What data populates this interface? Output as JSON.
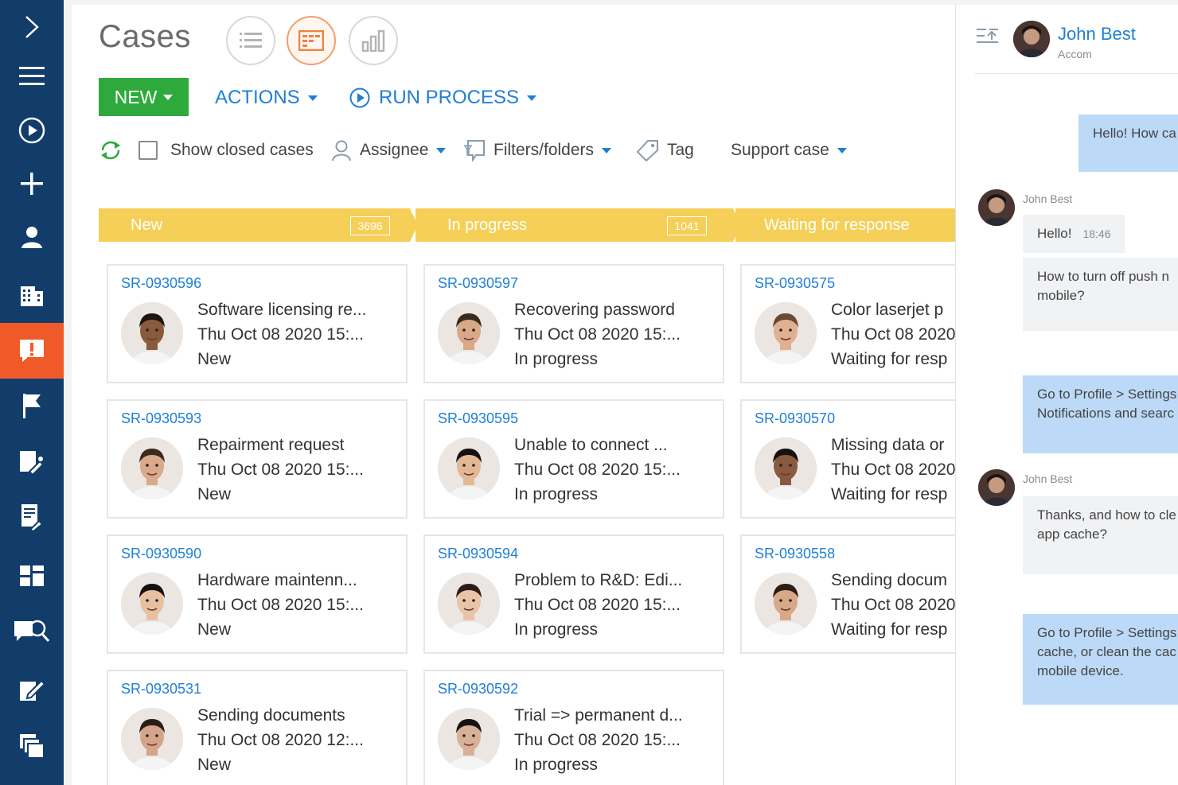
{
  "sidebar": {
    "items": [
      {
        "name": "expand",
        "icon": "chevron-right-icon"
      },
      {
        "name": "menu",
        "icon": "hamburger-icon"
      },
      {
        "name": "processes",
        "icon": "play-circle-icon"
      },
      {
        "name": "add",
        "icon": "plus-icon"
      },
      {
        "name": "contacts",
        "icon": "person-icon"
      },
      {
        "name": "accounts",
        "icon": "building-icon"
      },
      {
        "name": "cases",
        "icon": "alert-chat-icon",
        "active": true
      },
      {
        "name": "activities",
        "icon": "flag-icon"
      },
      {
        "name": "service-requests",
        "icon": "wrench-doc-icon"
      },
      {
        "name": "knowledge",
        "icon": "doc-wrench-icon"
      },
      {
        "name": "dashboards",
        "icon": "dashboard-icon"
      },
      {
        "name": "search-knowledge",
        "icon": "chat-search-icon"
      },
      {
        "name": "documents",
        "icon": "edit-doc-icon"
      },
      {
        "name": "files",
        "icon": "folders-icon"
      }
    ]
  },
  "header": {
    "title": "Cases",
    "views": [
      "list-view-icon",
      "board-view-icon",
      "analytics-view-icon"
    ],
    "active_view": "board-view-icon"
  },
  "toolbar": {
    "new_label": "NEW",
    "actions_label": "ACTIONS",
    "run_process_label": "RUN PROCESS"
  },
  "filters": {
    "show_closed_label": "Show closed cases",
    "assignee_label": "Assignee",
    "filters_label": "Filters/folders",
    "tag_label": "Tag",
    "support_label": "Support case"
  },
  "stages": [
    {
      "label": "New",
      "count": "3696"
    },
    {
      "label": "In progress",
      "count": "1041"
    },
    {
      "label": "Waiting for response",
      "count": ""
    }
  ],
  "columns": [
    {
      "cards": [
        {
          "id": "SR-0930596",
          "subject": "Software licensing re...",
          "date": "Thu Oct 08 2020 15:...",
          "status": "New",
          "avatar": {
            "skin": "#8a5a3c",
            "hair": "#1e1410"
          }
        },
        {
          "id": "SR-0930593",
          "subject": "Repairment request",
          "date": "Thu Oct 08 2020 15:...",
          "status": "New",
          "avatar": {
            "skin": "#d9a98a",
            "hair": "#3a2a20"
          }
        },
        {
          "id": "SR-0930590",
          "subject": "Hardware maintenn...",
          "date": "Thu Oct 08 2020 15:...",
          "status": "New",
          "avatar": {
            "skin": "#e8c0a0",
            "hair": "#141010"
          }
        },
        {
          "id": "SR-0930531",
          "subject": "Sending documents",
          "date": "Thu Oct 08 2020 12:...",
          "status": "New",
          "avatar": {
            "skin": "#d4a58a",
            "hair": "#2a1e18"
          }
        }
      ]
    },
    {
      "cards": [
        {
          "id": "SR-0930597",
          "subject": "Recovering password",
          "date": "Thu Oct 08 2020 15:...",
          "status": "In progress",
          "avatar": {
            "skin": "#d8a888",
            "hair": "#3a2a1e"
          }
        },
        {
          "id": "SR-0930595",
          "subject": "Unable to connect ...",
          "date": "Thu Oct 08 2020 15:...",
          "status": "In progress",
          "avatar": {
            "skin": "#e2b894",
            "hair": "#121010"
          }
        },
        {
          "id": "SR-0930594",
          "subject": "Problem to R&D: Edi...",
          "date": "Thu Oct 08 2020 15:...",
          "status": "In progress",
          "avatar": {
            "skin": "#e8c4a8",
            "hair": "#2c1e16"
          }
        },
        {
          "id": "SR-0930592",
          "subject": "Trial => permanent d...",
          "date": "Thu Oct 08 2020 15:...",
          "status": "In progress",
          "avatar": {
            "skin": "#d8b098",
            "hair": "#161212"
          }
        }
      ]
    },
    {
      "cards": [
        {
          "id": "SR-0930575",
          "subject": "Color laserjet p",
          "date": "Thu Oct 08 2020",
          "status": "Waiting for resp",
          "avatar": {
            "skin": "#e0b090",
            "hair": "#6a4a30"
          }
        },
        {
          "id": "SR-0930570",
          "subject": "Missing data or",
          "date": "Thu Oct 08 2020",
          "status": "Waiting for resp",
          "avatar": {
            "skin": "#8a5a40",
            "hair": "#161010"
          }
        },
        {
          "id": "SR-0930558",
          "subject": "Sending docum",
          "date": "Thu Oct 08 2020",
          "status": "Waiting for resp",
          "avatar": {
            "skin": "#d8a888",
            "hair": "#2a1e16"
          }
        }
      ]
    }
  ],
  "chat": {
    "contact_name": "John Best",
    "contact_sub": "Accom",
    "messages": [
      {
        "type": "outgoing",
        "lines": [
          "Hello! How ca"
        ]
      },
      {
        "type": "incoming",
        "author": "John Best",
        "lines": [
          "Hello!"
        ],
        "time": "18:46"
      },
      {
        "type": "incoming",
        "lines": [
          "How to turn off push n",
          "mobile?"
        ]
      },
      {
        "type": "outgoing",
        "lines": [
          "Go to Profile > Settings",
          "Notifications and searc"
        ]
      },
      {
        "type": "incoming",
        "author": "John Best",
        "lines": [
          "Thanks, and how to cle",
          "app cache?"
        ]
      },
      {
        "type": "outgoing",
        "lines": [
          "Go to Profile > Settings",
          "cache, or clean the cac",
          "mobile device."
        ]
      }
    ]
  },
  "colors": {
    "sidebar": "#123d6a",
    "active_nav": "#f05a28",
    "accent_blue": "#1f7fd6",
    "new_button": "#2eaa3c",
    "stage": "#f5cf57",
    "outgoing_bubble": "#bcdaf7"
  }
}
